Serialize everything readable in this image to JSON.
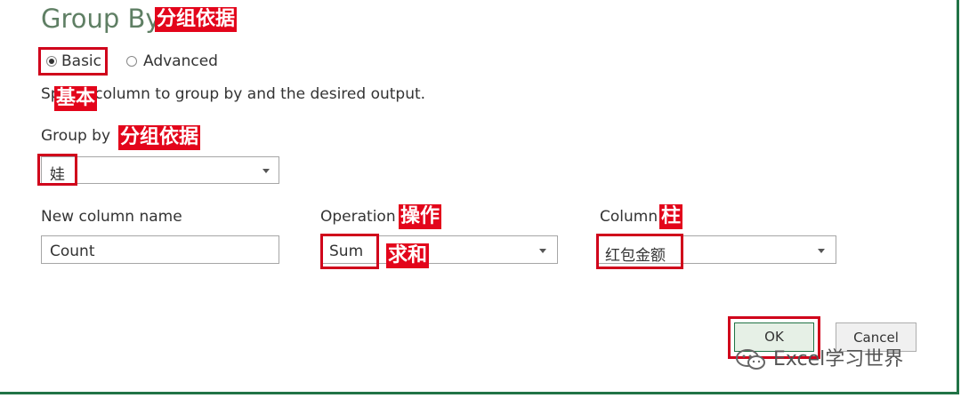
{
  "dialog": {
    "title": "Group By",
    "title_annotation": "分组依据",
    "mode": {
      "basic_label": "Basic",
      "advanced_label": "Advanced",
      "basic_annotation": "基本"
    },
    "instruction": "Sp the column to group by and the desired output.",
    "group_by": {
      "label": "Group by",
      "annotation": "分组依据",
      "value": "娃"
    },
    "new_column": {
      "label": "New column name",
      "value": "Count"
    },
    "operation": {
      "label": "Operation",
      "annotation": "操作",
      "value": "Sum",
      "value_annotation": "求和"
    },
    "column": {
      "label": "Column",
      "annotation": "柱",
      "value": "红包金额"
    },
    "ok_label": "OK",
    "cancel_label": "Cancel",
    "watermark": "Excel学习世界"
  },
  "colors": {
    "accent": "#217346",
    "annotation_red": "#e3051b",
    "title": "#5f7f64"
  }
}
